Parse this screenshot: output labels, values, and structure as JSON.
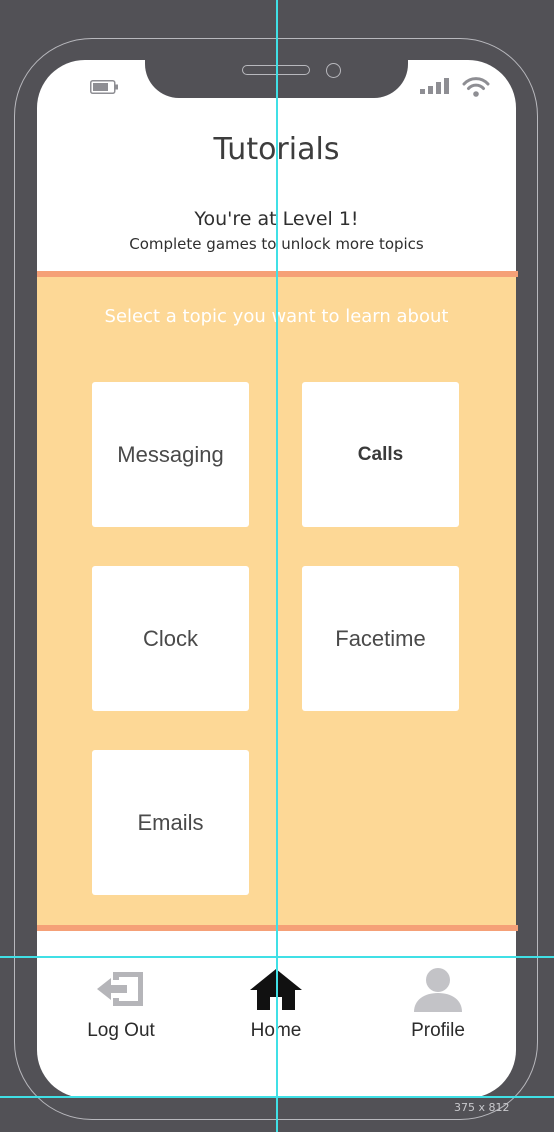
{
  "status_bar": {
    "battery_icon": "battery-icon",
    "signal_icon": "cellular-signal-icon",
    "wifi_icon": "wifi-icon"
  },
  "header": {
    "title": "Tutorials",
    "level_text": "You're at Level 1!",
    "level_subtext": "Complete games to unlock more topics"
  },
  "topics": {
    "prompt": "Select a topic you want to learn about",
    "items": [
      {
        "label": "Messaging"
      },
      {
        "label": "Calls"
      },
      {
        "label": "Clock"
      },
      {
        "label": "Facetime"
      },
      {
        "label": "Emails"
      }
    ]
  },
  "nav": {
    "items": [
      {
        "label": "Log Out",
        "icon": "logout-icon"
      },
      {
        "label": "Home",
        "icon": "home-icon"
      },
      {
        "label": "Profile",
        "icon": "profile-icon"
      }
    ]
  },
  "canvas": {
    "dimensions_label": "375 x 812"
  },
  "colors": {
    "background": "#525156",
    "accent_line": "#f5a077",
    "topic_panel": "#fdd896",
    "guide": "#40e0e6"
  }
}
